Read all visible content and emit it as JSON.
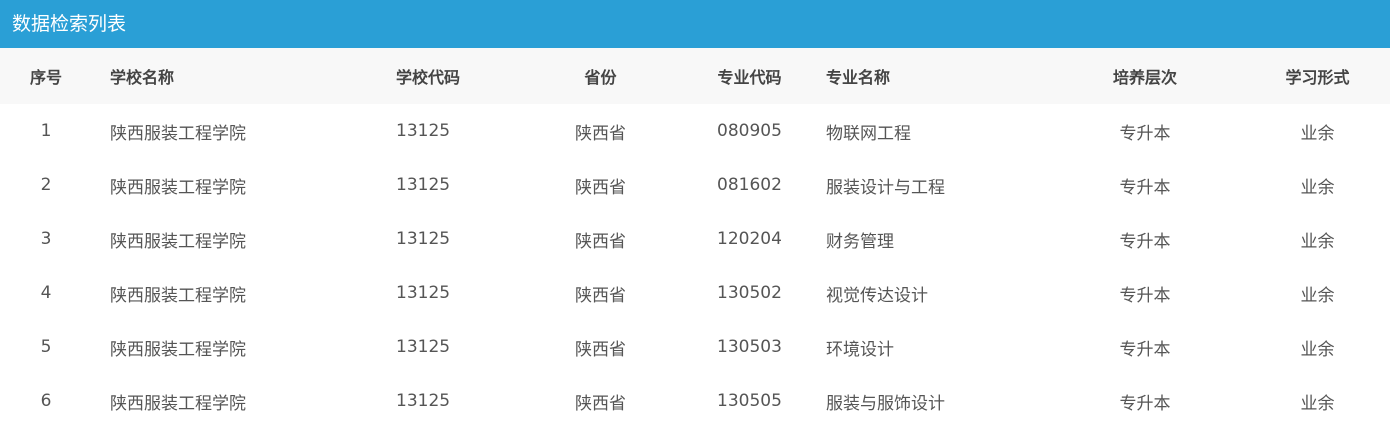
{
  "panel": {
    "title": "数据检索列表"
  },
  "table": {
    "columns": [
      "序号",
      "学校名称",
      "学校代码",
      "省份",
      "专业代码",
      "专业名称",
      "培养层次",
      "学习形式"
    ],
    "rows": [
      [
        "1",
        "陕西服装工程学院",
        "13125",
        "陕西省",
        "080905",
        "物联网工程",
        "专升本",
        "业余"
      ],
      [
        "2",
        "陕西服装工程学院",
        "13125",
        "陕西省",
        "081602",
        "服装设计与工程",
        "专升本",
        "业余"
      ],
      [
        "3",
        "陕西服装工程学院",
        "13125",
        "陕西省",
        "120204",
        "财务管理",
        "专升本",
        "业余"
      ],
      [
        "4",
        "陕西服装工程学院",
        "13125",
        "陕西省",
        "130502",
        "视觉传达设计",
        "专升本",
        "业余"
      ],
      [
        "5",
        "陕西服装工程学院",
        "13125",
        "陕西省",
        "130503",
        "环境设计",
        "专升本",
        "业余"
      ],
      [
        "6",
        "陕西服装工程学院",
        "13125",
        "陕西省",
        "130505",
        "服装与服饰设计",
        "专升本",
        "业余"
      ]
    ]
  },
  "colors": {
    "header_bg": "#2a9fd6",
    "table_head_bg": "#f8f8f8"
  }
}
